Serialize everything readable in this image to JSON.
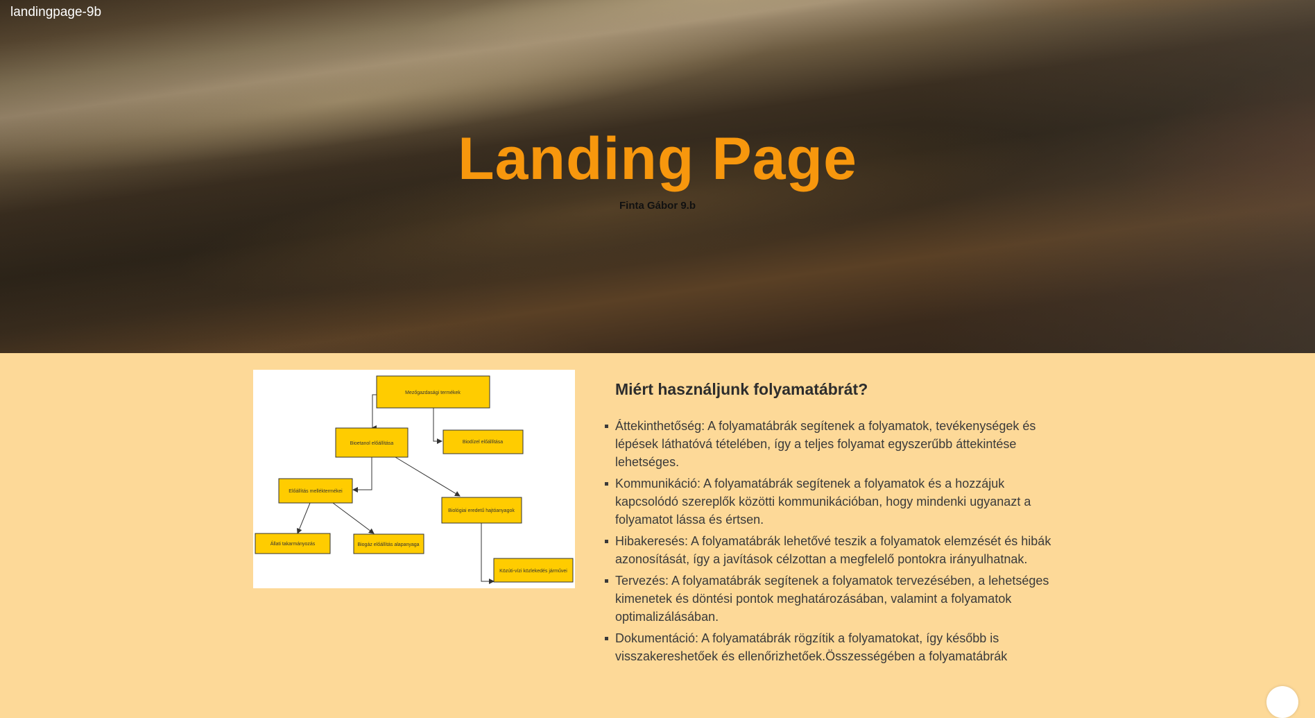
{
  "header": {
    "brand": "landingpage-9b",
    "title": "Landing Page",
    "subtitle": "Finta Gábor 9.b"
  },
  "diagram": {
    "nodes": [
      "Mezőgazdasági termékek",
      "Bioetanol előállítása",
      "Biodízel előállítása",
      "Előállítás melléktermékei",
      "Biológiai eredetű hajtóanyagok",
      "Állati takarmányozás",
      "Biogáz előállítás alapanyaga",
      "Közúti-vízi közlekedés járművei"
    ],
    "colors": {
      "node_fill": "#ffcc00",
      "node_stroke": "#333333"
    }
  },
  "section": {
    "heading": "Miért használjunk folyamatábrát?",
    "items": [
      "Áttekinthetőség: A folyamatábrák segítenek a folyamatok, tevékenységek és lépések láthatóvá tételében, így a teljes folyamat egyszerűbb áttekintése lehetséges.",
      "Kommunikáció: A folyamatábrák segítenek a folyamatok és a hozzájuk kapcsolódó szereplők közötti kommunikációban, hogy mindenki ugyanazt a folyamatot lássa és értsen.",
      "Hibakeresés: A folyamatábrák lehetővé teszik a folyamatok elemzését és hibák azonosítását, így a javítások célzottan a megfelelő pontokra irányulhatnak.",
      "Tervezés: A folyamatábrák segítenek a folyamatok tervezésében, a lehetséges kimenetek és döntési pontok meghatározásában, valamint a folyamatok optimalizálásában.",
      "Dokumentáció: A folyamatábrák rögzítik a folyamatokat, így később is visszakereshetőek és ellenőrizhetőek.Összességében a folyamatábrák"
    ]
  },
  "theme": {
    "accent": "#f7970d",
    "background": "#fdd998"
  }
}
